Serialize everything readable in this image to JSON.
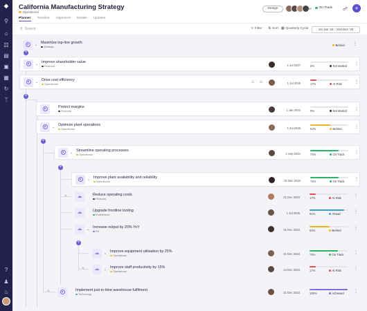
{
  "app": {
    "title": "California Manufacturing Strategy",
    "status": "Operational",
    "status_color": "#f0b429"
  },
  "header": {
    "tabs": [
      "Planner",
      "Timeline",
      "Alignment",
      "Details",
      "Updates"
    ],
    "active_tab": "Planner",
    "design_label": "Design",
    "avatar_extra": "+10",
    "track_status": "On Track",
    "track_color": "#2fb36a"
  },
  "toolbar": {
    "search_placeholder": "Search",
    "filter_label": "Filter",
    "sort_label": "Sort",
    "cycle_label": "Quarterly Cycle",
    "date_range": "1st Jan '23 - 31st Dec '25"
  },
  "colors": {
    "on_track": "#2fb36a",
    "behind": "#f0b429",
    "at_risk": "#e5484d",
    "ahead": "#3b9be8",
    "achieved": "#7a6ee0",
    "not_started": "#333333",
    "accent": "#5b4fcf"
  },
  "rows": [
    {
      "title": "Maximize top-line growth",
      "category": "Strategic",
      "cat_color": "#333333",
      "date": "",
      "progress": "",
      "status": "Behind",
      "status_color": "#f0b429",
      "fill": 0
    },
    {
      "title": "Improve shareholder value",
      "category": "Financial",
      "cat_color": "#333333",
      "date": "1 Jul 2027",
      "progress": "0%",
      "status": "Not started",
      "status_color": "#333333",
      "fill": 0
    },
    {
      "title": "Drive cost efficiency",
      "category": "Operational",
      "cat_color": "#f0b429",
      "date": "1 Jul 2025",
      "progress": "17%",
      "status": "At Risk",
      "status_color": "#e5484d",
      "fill": 0.17
    },
    {
      "title": "Protect margins",
      "category": "Financial",
      "cat_color": "#333333",
      "date": "1 Jan 2024",
      "progress": "0%",
      "status": "Not started",
      "status_color": "#333333",
      "fill": 0
    },
    {
      "title": "Optimize plant operations",
      "category": "Operational",
      "cat_color": "#f0b429",
      "date": "1 Jul 2025",
      "progress": "52%",
      "status": "Behind",
      "status_color": "#f0b429",
      "fill": 0.52
    },
    {
      "title": "Streamline operating processes",
      "category": "Operational",
      "cat_color": "#f0b429",
      "date": "1 Sep 2024",
      "progress": "74%",
      "status": "On Track",
      "status_color": "#2fb36a",
      "fill": 0.74
    },
    {
      "title": "Improve plant availability and reliability",
      "category": "Operational",
      "cat_color": "#f0b429",
      "date": "31 Dec 2023",
      "progress": "74%",
      "status": "On Track",
      "status_color": "#2fb36a",
      "fill": 0.74
    },
    {
      "title": "Reduce operating costs",
      "category": "Financial",
      "cat_color": "#333333",
      "date": "31 Dec 2023",
      "progress": "17%",
      "status": "At Risk",
      "status_color": "#e5484d",
      "fill": 0.17
    },
    {
      "title": "Upgrade frontline tooling",
      "category": "Enablement",
      "cat_color": "#2fb36a",
      "date": "1 Jul 2025",
      "progress": "91%",
      "status": "Ahead",
      "status_color": "#3b9be8",
      "fill": 0.91
    },
    {
      "title": "Increase output by 20% YoY",
      "category": "KR",
      "cat_color": "#7a6ee0",
      "date": "31 Dec 2023",
      "progress": "52%",
      "status": "Behind",
      "status_color": "#f0b429",
      "fill": 0.52
    },
    {
      "title": "Improve equipment utilisation by 25%",
      "category": "Operational",
      "cat_color": "#f0b429",
      "date": "31 Dec 2023",
      "progress": "74%",
      "status": "On Track",
      "status_color": "#2fb36a",
      "fill": 0.74
    },
    {
      "title": "Improve staff productivity by 15%",
      "category": "Operational",
      "cat_color": "#f0b429",
      "date": "24 Dec 2023",
      "progress": "17%",
      "status": "At Risk",
      "status_color": "#e5484d",
      "fill": 0.17
    },
    {
      "title": "Implement just-in-time warehouse fulfilment",
      "category": "Technology",
      "cat_color": "#3b9be8",
      "date": "31 Dec 2023",
      "progress": "100%",
      "status": "Achieved",
      "status_color": "#7a6ee0",
      "fill": 1.0
    }
  ]
}
